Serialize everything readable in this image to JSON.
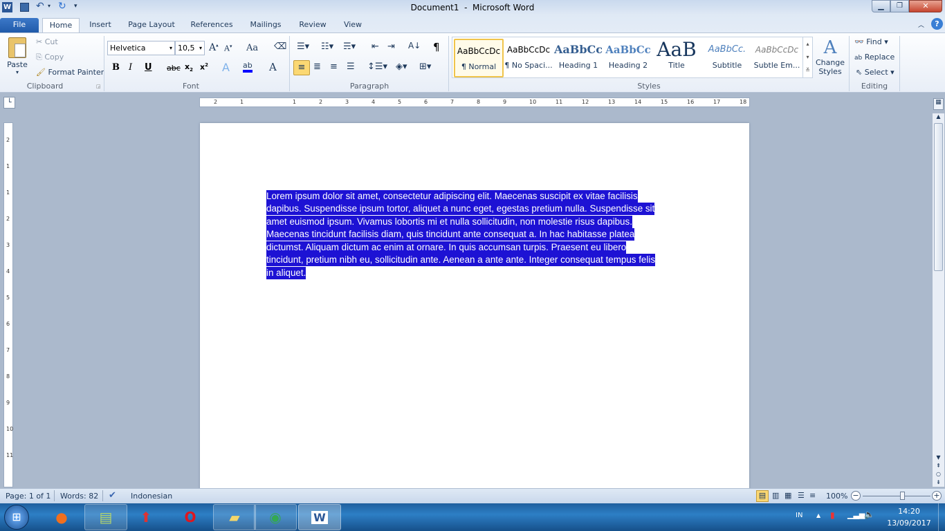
{
  "window": {
    "title": "Document1  -  Microsoft Word"
  },
  "tabs": [
    {
      "label": "File"
    },
    {
      "label": "Home"
    },
    {
      "label": "Insert"
    },
    {
      "label": "Page Layout"
    },
    {
      "label": "References"
    },
    {
      "label": "Mailings"
    },
    {
      "label": "Review"
    },
    {
      "label": "View"
    }
  ],
  "clipboard": {
    "paste": "Paste",
    "cut": "Cut",
    "copy": "Copy",
    "format_painter": "Format Painter",
    "label": "Clipboard"
  },
  "font": {
    "name": "Helvetica",
    "size": "10,5",
    "label": "Font",
    "bold": "B",
    "italic": "I",
    "underline": "U",
    "strike": "abc",
    "change_case": "Aa"
  },
  "paragraph": {
    "label": "Paragraph",
    "show_marks": "¶"
  },
  "styles": {
    "label": "Styles",
    "items": [
      {
        "preview": "AaBbCcDc",
        "name": "¶ Normal"
      },
      {
        "preview": "AaBbCcDc",
        "name": "¶ No Spaci..."
      },
      {
        "preview": "AaBbCc",
        "name": "Heading 1"
      },
      {
        "preview": "AaBbCc",
        "name": "Heading 2"
      },
      {
        "preview": "AaB",
        "name": "Title"
      },
      {
        "preview": "AaBbCc.",
        "name": "Subtitle"
      },
      {
        "preview": "AaBbCcDc",
        "name": "Subtle Em..."
      }
    ],
    "change_styles": "Change Styles"
  },
  "editing": {
    "label": "Editing",
    "find": "Find",
    "replace": "Replace",
    "select": "Select"
  },
  "ruler": {
    "ticks": [
      "2",
      "1",
      "1",
      "2",
      "3",
      "4",
      "5",
      "6",
      "7",
      "8",
      "9",
      "10",
      "11",
      "12",
      "13",
      "14",
      "15",
      "16",
      "17",
      "18"
    ],
    "vticks": [
      "2",
      "1",
      "1",
      "2",
      "3",
      "4",
      "5",
      "6",
      "7",
      "8",
      "9",
      "10",
      "11"
    ]
  },
  "document": {
    "lines": [
      "Lorem ipsum dolor sit amet, consectetur adipiscing elit. Maecenas suscipit ex vitae facilisis",
      "dapibus. Suspendisse ipsum tortor, aliquet a nunc eget, egestas pretium nulla. Suspendisse sit",
      "amet euismod ipsum. Vivamus lobortis mi et nulla sollicitudin, non molestie risus dapibus.",
      "Maecenas tincidunt facilisis diam, quis tincidunt ante consequat a. In hac habitasse platea",
      "dictumst. Aliquam dictum ac enim at ornare. In quis accumsan turpis. Praesent eu libero",
      "tincidunt, pretium nibh eu, sollicitudin ante. Aenean a ante ante. Integer consequat tempus felis",
      "in aliquet."
    ],
    "selection_color": "#1d12d4"
  },
  "status": {
    "page": "Page: 1 of 1",
    "words": "Words: 82",
    "language": "Indonesian",
    "zoom": "100%",
    "zoom_level": 100
  },
  "taskbar": {
    "lang": "IN",
    "time": "14:20",
    "date": "13/09/2017"
  }
}
